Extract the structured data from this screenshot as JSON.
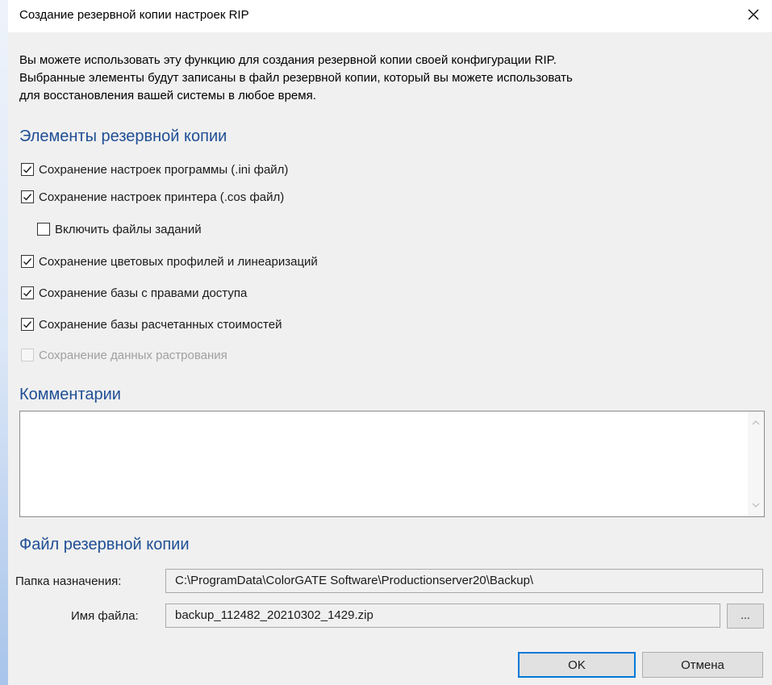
{
  "window": {
    "title": "Создание резервной копии настроек RIP"
  },
  "intro": {
    "line1": "Вы можете использовать эту функцию для создания резервной копии своей конфигурации RIP.",
    "line2": "Выбранные элементы будут записаны в файл резервной копии, который вы можете использовать",
    "line3": "для восстановления вашей системы в любое время."
  },
  "backup_items": {
    "title": "Элементы резервной копии",
    "items": [
      {
        "label": "Сохранение настроек программы (.ini файл)",
        "checked": true,
        "enabled": true
      },
      {
        "label": "Сохранение настроек принтера (.cos файл)",
        "checked": true,
        "enabled": true
      },
      {
        "label": "Включить файлы заданий",
        "checked": false,
        "enabled": true
      },
      {
        "label": "Сохранение цветовых профилей и линеаризаций",
        "checked": true,
        "enabled": true
      },
      {
        "label": "Сохранение базы с правами доступа",
        "checked": true,
        "enabled": true
      },
      {
        "label": "Сохранение базы расчетанных стоимостей",
        "checked": true,
        "enabled": true
      },
      {
        "label": "Сохранение данных растрования",
        "checked": false,
        "enabled": false
      }
    ]
  },
  "comments": {
    "title": "Комментарии",
    "value": ""
  },
  "backup_file": {
    "title": "Файл резервной копии",
    "folder_label": "Папка назначения:",
    "folder_value": "C:\\ProgramData\\ColorGATE Software\\Productionserver20\\Backup\\",
    "filename_label": "Имя файла:",
    "filename_value": "backup_112482_20210302_1429.zip",
    "browse_label": "..."
  },
  "buttons": {
    "ok": "OK",
    "cancel": "Отмена"
  },
  "colors": {
    "section_title": "#1f4e95",
    "primary_border": "#0078d7"
  },
  "icons": {
    "close": "close-icon",
    "check": "check-icon",
    "scroll_up": "chevron-up-icon",
    "scroll_down": "chevron-down-icon"
  }
}
